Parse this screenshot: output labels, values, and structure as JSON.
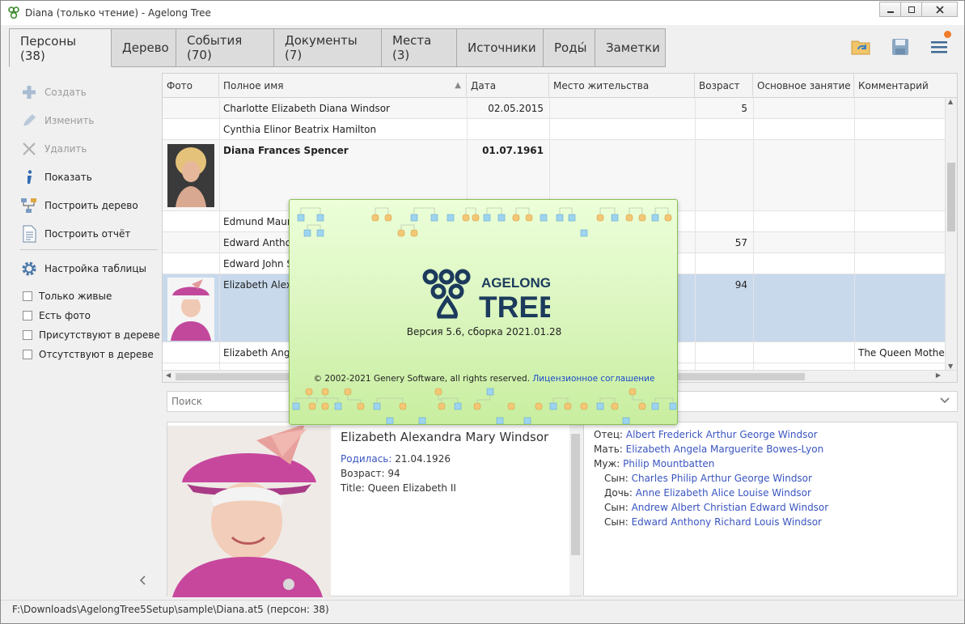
{
  "window": {
    "title": "Diana (только чтение) - Agelong Tree"
  },
  "tabs": [
    {
      "label": "Персоны (38)"
    },
    {
      "label": "Дерево"
    },
    {
      "label": "События (70)"
    },
    {
      "label": "Документы (7)"
    },
    {
      "label": "Места (3)"
    },
    {
      "label": "Источники"
    },
    {
      "label": "Роды́"
    },
    {
      "label": "Заметки"
    }
  ],
  "actions": [
    {
      "label": "Создать",
      "icon": "plus-icon"
    },
    {
      "label": "Изменить",
      "icon": "pencil-icon"
    },
    {
      "label": "Удалить",
      "icon": "x-icon"
    },
    {
      "label": "Показать",
      "icon": "info-icon"
    },
    {
      "label": "Построить дерево",
      "icon": "tree-icon"
    },
    {
      "label": "Построить отчёт",
      "icon": "document-icon"
    }
  ],
  "table_settings": {
    "label": "Настройка таблицы",
    "icon": "gear-icon"
  },
  "filters": [
    {
      "label": "Только живые"
    },
    {
      "label": "Есть фото"
    },
    {
      "label": "Присутствуют в дереве"
    },
    {
      "label": "Отсутствуют в дереве"
    }
  ],
  "grid": {
    "columns": [
      "Фото",
      "Полное имя",
      "Дата рождения",
      "Место жительства",
      "Возраст",
      "Основное занятие",
      "Комментарий"
    ],
    "rows": [
      {
        "name": "Charlotte Elizabeth Diana Windsor",
        "birth": "02.05.2015",
        "age": "5",
        "comment": ""
      },
      {
        "name": "Cynthia Elinor Beatrix Hamilton",
        "birth": "",
        "age": "",
        "comment": ""
      },
      {
        "name": "Diana Frances Spencer",
        "birth": "01.07.1961",
        "age": "",
        "comment": ""
      },
      {
        "name": "Edmund Maur",
        "birth": "",
        "age": "",
        "comment": ""
      },
      {
        "name": "Edward Antho",
        "birth": "",
        "age": "57",
        "comment": ""
      },
      {
        "name": "Edward John S",
        "birth": "",
        "age": "",
        "comment": ""
      },
      {
        "name": "Elizabeth Alexa",
        "birth": "",
        "age": "94",
        "comment": ""
      },
      {
        "name": "Elizabeth Ange",
        "birth": "",
        "age": "",
        "comment": "The Queen Mother"
      }
    ]
  },
  "search": {
    "placeholder": "Поиск"
  },
  "detail": {
    "name": "Elizabeth Alexandra Mary Windsor",
    "born_label": "Родилась:",
    "born_value": "21.04.1926",
    "age": "Возраст: 94",
    "title": "Title: Queen Elizabeth II"
  },
  "relations": [
    {
      "label": "Отец:",
      "value": "Albert Frederick Arthur George Windsor",
      "indent": false
    },
    {
      "label": "Мать:",
      "value": "Elizabeth Angela Marguerite Bowes-Lyon",
      "indent": false
    },
    {
      "label": "Муж:",
      "value": "Philip Mountbatten",
      "indent": false
    },
    {
      "label": "Сын:",
      "value": "Charles Philip Arthur George Windsor",
      "indent": true
    },
    {
      "label": "Дочь:",
      "value": "Anne Elizabeth Alice Louise Windsor",
      "indent": true
    },
    {
      "label": "Сын:",
      "value": "Andrew Albert Christian Edward Windsor",
      "indent": true
    },
    {
      "label": "Сын:",
      "value": "Edward Anthony Richard Louis Windsor",
      "indent": true
    }
  ],
  "status": "F:\\Downloads\\AgelongTree5Setup\\sample\\Diana.at5 (персон: 38)",
  "splash": {
    "brand_top": "AGELONG",
    "brand_bottom": "TREE",
    "version": "Версия 5.6, сборка 2021.01.28",
    "copyright": "© 2002-2021 Genery Software, all rights reserved.",
    "license_link": "Лицензионное соглашение"
  },
  "colors": {
    "accent": "#3a55c0",
    "selected_row": "#c8d9ec",
    "splash_green": "#c8ee9f",
    "logo_navy": "#1b3a5c"
  }
}
